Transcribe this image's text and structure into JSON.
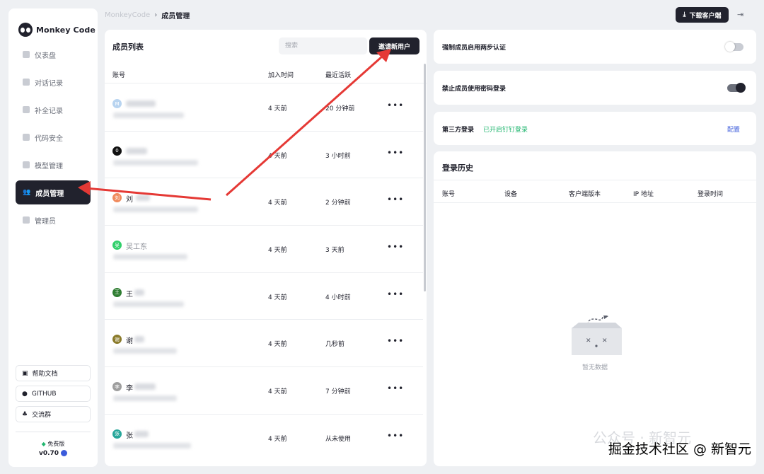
{
  "app": {
    "name": "Monkey Code"
  },
  "sidebar": {
    "items": [
      {
        "label": "仪表盘",
        "active": false
      },
      {
        "label": "对话记录",
        "active": false
      },
      {
        "label": "补全记录",
        "active": false
      },
      {
        "label": "代码安全",
        "active": false
      },
      {
        "label": "模型管理",
        "active": false
      },
      {
        "label": "成员管理",
        "active": true
      },
      {
        "label": "管理员",
        "active": false
      }
    ],
    "links": [
      {
        "label": "帮助文档",
        "icon": "document-icon"
      },
      {
        "label": "GITHUB",
        "icon": "github-icon"
      },
      {
        "label": "交流群",
        "icon": "group-icon"
      }
    ],
    "plan": "免费版",
    "version": "v0.70"
  },
  "header": {
    "breadcrumb_root": "MonkeyCode",
    "breadcrumb_sep": "›",
    "breadcrumb_current": "成员管理",
    "download_label": "下载客户端"
  },
  "members": {
    "title": "成员列表",
    "search_placeholder": "搜索",
    "invite_label": "邀请新用户",
    "columns": {
      "account": "账号",
      "joined": "加入时间",
      "last_active": "最近活跃"
    },
    "rows": [
      {
        "avatar": "M",
        "avatar_color": "#b8d4f0",
        "name": "",
        "joined": "4 天前",
        "last_active": "20 分钟前"
      },
      {
        "avatar": "0",
        "avatar_color": "#111111",
        "name": "",
        "joined": "4 天前",
        "last_active": "3 小时前"
      },
      {
        "avatar": "刘",
        "avatar_color": "#f08a5d",
        "name": "刘",
        "joined": "4 天前",
        "last_active": "2 分钟前"
      },
      {
        "avatar": "吴",
        "avatar_color": "#2fcf6a",
        "name": "吴工东",
        "joined": "4 天前",
        "last_active": "3 天前"
      },
      {
        "avatar": "王",
        "avatar_color": "#2f7d32",
        "name": "王",
        "joined": "4 天前",
        "last_active": "4 小时前"
      },
      {
        "avatar": "谢",
        "avatar_color": "#8a7a2a",
        "name": "谢",
        "joined": "4 天前",
        "last_active": "几秒前"
      },
      {
        "avatar": "李",
        "avatar_color": "#9e9e9e",
        "name": "李",
        "joined": "4 天前",
        "last_active": "7 分钟前"
      },
      {
        "avatar": "张",
        "avatar_color": "#26a69a",
        "name": "张",
        "joined": "4 天前",
        "last_active": "从未使用"
      }
    ],
    "more_label": "•••"
  },
  "settings": {
    "two_factor": {
      "label": "强制成员启用两步认证",
      "enabled": false
    },
    "disable_password": {
      "label": "禁止成员使用密码登录",
      "enabled": true
    },
    "third_party": {
      "label": "第三方登录",
      "status": "已开启钉钉登录",
      "action": "配置"
    }
  },
  "history": {
    "title": "登录历史",
    "columns": {
      "account": "账号",
      "device": "设备",
      "client_version": "客户端版本",
      "ip": "IP 地址",
      "login_time": "登录时间"
    },
    "empty": "暂无数据"
  },
  "watermark": {
    "primary": "掘金技术社区 @ 新智元",
    "faint": "公众号 · 新智元"
  },
  "colors": {
    "primary_dark": "#21222d",
    "success": "#21b66f",
    "link": "#3b5bdb",
    "annotation_red": "#e53935"
  }
}
